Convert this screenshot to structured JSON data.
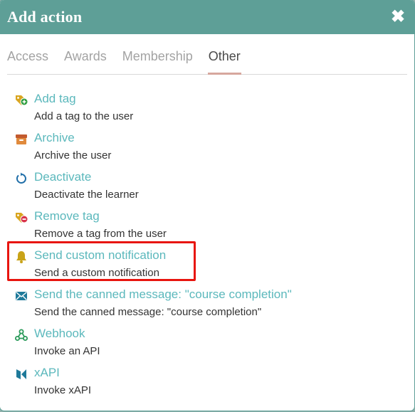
{
  "dialog": {
    "title": "Add action",
    "close_glyph": "✖"
  },
  "tabs": [
    {
      "label": "Access",
      "active": false
    },
    {
      "label": "Awards",
      "active": false
    },
    {
      "label": "Membership",
      "active": false
    },
    {
      "label": "Other",
      "active": true
    }
  ],
  "actions": [
    {
      "name": "Add tag",
      "description": "Add a tag to the user",
      "icon": "tag-add-icon"
    },
    {
      "name": "Archive",
      "description": "Archive the user",
      "icon": "archive-icon"
    },
    {
      "name": "Deactivate",
      "description": "Deactivate the learner",
      "icon": "deactivate-icon"
    },
    {
      "name": "Remove tag",
      "description": "Remove a tag from the user",
      "icon": "tag-remove-icon"
    },
    {
      "name": "Send custom notification",
      "description": "Send a custom notification",
      "icon": "bell-icon"
    },
    {
      "name": "Send the canned message: \"course completion\"",
      "description": "Send the canned message: \"course completion\"",
      "icon": "envelope-icon"
    },
    {
      "name": "Webhook",
      "description": "Invoke an API",
      "icon": "webhook-icon"
    },
    {
      "name": "xAPI",
      "description": "Invoke xAPI",
      "icon": "xapi-icon"
    }
  ],
  "colors": {
    "header": "#5e9f97",
    "link": "#5bb8bc",
    "active_tab_underline": "#d7a79e",
    "highlight_border": "#e8150f"
  }
}
